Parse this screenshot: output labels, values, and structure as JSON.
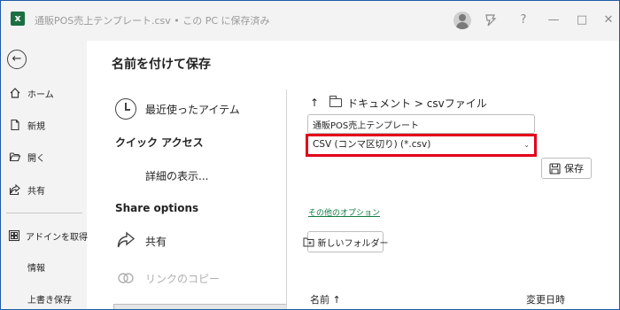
{
  "window": {
    "app_icon_letter": "x",
    "title": "通販POS売上テンプレート.csv • この PC に保存済み",
    "buttons": [
      "?",
      "—",
      "□",
      "✕"
    ]
  },
  "nav": {
    "items": [
      {
        "label": "ホーム",
        "icon": "home-icon"
      },
      {
        "label": "新規",
        "icon": "new-file-icon"
      },
      {
        "label": "開く",
        "icon": "open-folder-icon"
      },
      {
        "label": "共有",
        "icon": "share-icon"
      },
      {
        "label": "アドインを取得",
        "icon": "addins-icon"
      },
      {
        "label": "情報",
        "icon": ""
      },
      {
        "label": "上書き保存",
        "icon": ""
      }
    ]
  },
  "middle": {
    "title": "名前を付けて保存",
    "recent": "最近使ったアイテム",
    "quick_access": "クイック アクセス",
    "show_details": "詳細の表示...",
    "share_options": "Share options",
    "share": "共有",
    "copy_link": "リンクのコピー"
  },
  "right": {
    "breadcrumb_up": "↑",
    "breadcrumb": "ドキュメント > csvファイル",
    "filename": "通販POS売上テンプレート",
    "filetype": "CSV (コンマ区切り) (*.csv)",
    "save_label": "保存",
    "other_options": "その他のオプション",
    "new_folder": "新しいフォルダー",
    "col_name": "名前 ↑",
    "col_modified": "変更日時"
  },
  "colors": {
    "accent_green": "#107c41",
    "excel_green": "#1d6f42",
    "highlight_red": "#e3001b"
  }
}
